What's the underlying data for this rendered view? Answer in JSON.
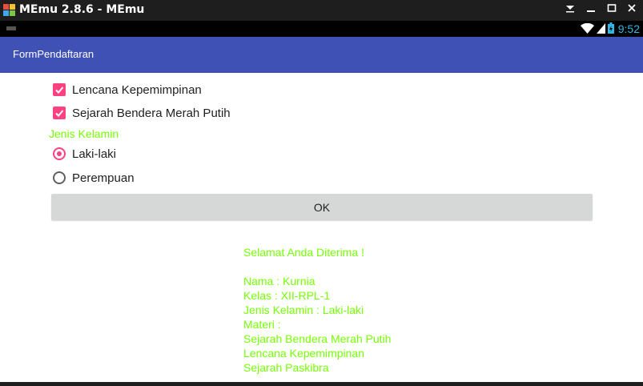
{
  "window": {
    "title": "MEmu 2.8.6 - MEmu",
    "controls": [
      "menu-icon",
      "minimize-icon",
      "maximize-icon",
      "close-icon"
    ]
  },
  "status_bar": {
    "time": "9:52",
    "icons": [
      "wifi-icon",
      "signal-icon",
      "battery-icon"
    ]
  },
  "app_bar": {
    "title": "FormPendaftaran",
    "color": "#3f51b5"
  },
  "form": {
    "checkboxes": [
      {
        "label": "Lencana Kepemimpinan",
        "checked": true
      },
      {
        "label": "Sejarah Bendera Merah Putih",
        "checked": true
      }
    ],
    "gender_label": "Jenis Kelamin",
    "radios": [
      {
        "label": "Laki-laki",
        "selected": true
      },
      {
        "label": "Perempuan",
        "selected": false
      }
    ],
    "ok_label": "OK"
  },
  "result": {
    "greeting": "Selamat Anda Diterima !",
    "lines": [
      "Nama : Kurnia",
      "Kelas : XII-RPL-1",
      "Jenis Kelamin : Laki-laki",
      "Materi :",
      "Sejarah Bendera Merah Putih",
      "Lencana Kepemimpinan",
      "Sejarah Paskibra"
    ]
  },
  "colors": {
    "accent": "#ff4081",
    "result_text": "#76ff03",
    "status_time": "#33b5e5"
  }
}
